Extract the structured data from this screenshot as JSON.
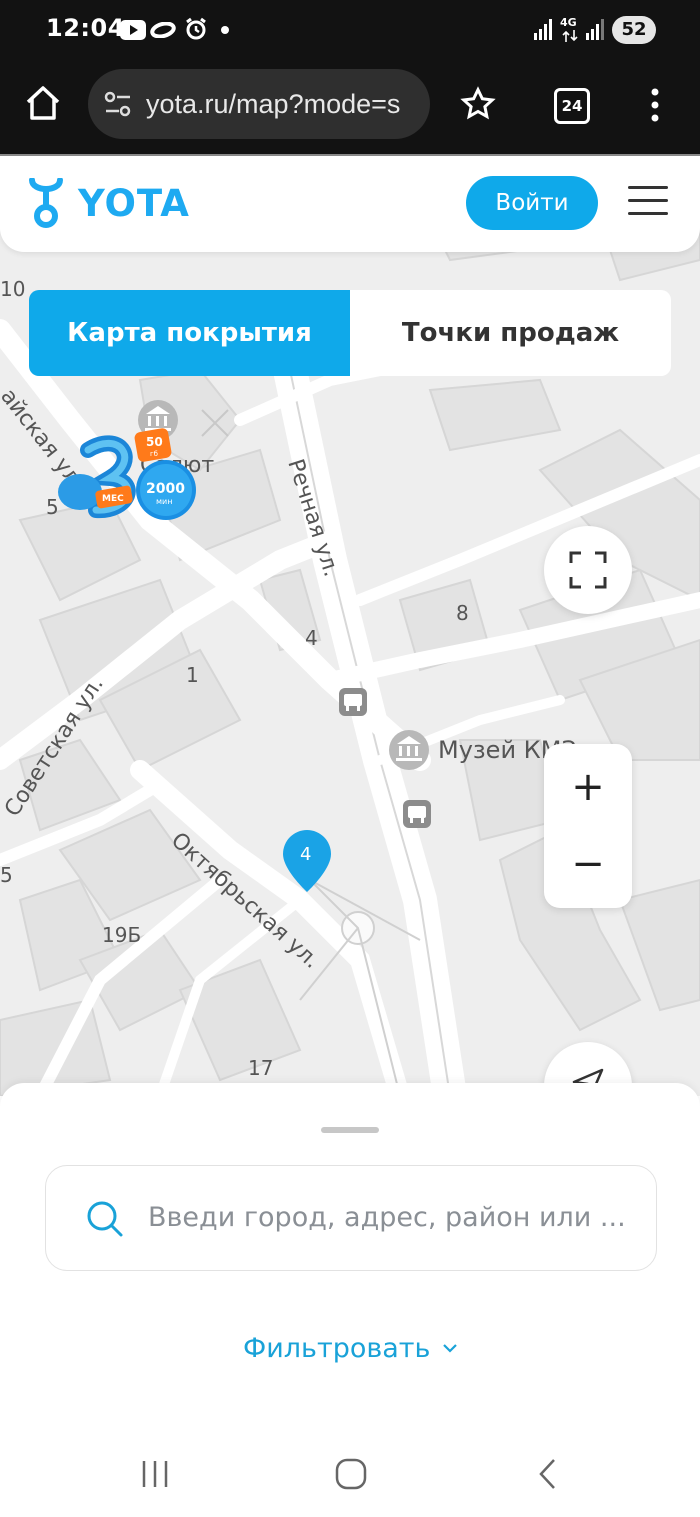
{
  "status_bar": {
    "time": "12:04",
    "network_type": "4G",
    "battery": "52"
  },
  "browser": {
    "url": "yota.ru/map?mode=s",
    "tab_count": "24"
  },
  "header": {
    "logo": "YOTA",
    "login_label": "Войти"
  },
  "tabs": [
    {
      "label": "Карта покрытия",
      "active": true
    },
    {
      "label": "Точки продаж",
      "active": false
    }
  ],
  "map": {
    "streets": [
      "Речная ул.",
      "Советская ул.",
      "Октябрьская ул.",
      "айская ул."
    ],
    "places": [
      "Салют",
      "Музей КМЗ"
    ],
    "house_numbers": [
      "10",
      "5",
      "8",
      "4",
      "1",
      "5",
      "19Б",
      "17"
    ],
    "promo": {
      "data_badge": "50",
      "data_unit": "гб",
      "minutes_badge": "2000",
      "minutes_unit": "мин",
      "month_badge": "МЕС"
    },
    "pin_label": "4",
    "zoom_in": "+",
    "zoom_out": "−"
  },
  "sheet": {
    "search_placeholder": "Введи город, адрес, район или ...",
    "filter_label": "Фильтровать"
  },
  "colors": {
    "accent": "#0fa9ea",
    "status_bar": "#121212",
    "map_bg": "#eeeeee"
  }
}
